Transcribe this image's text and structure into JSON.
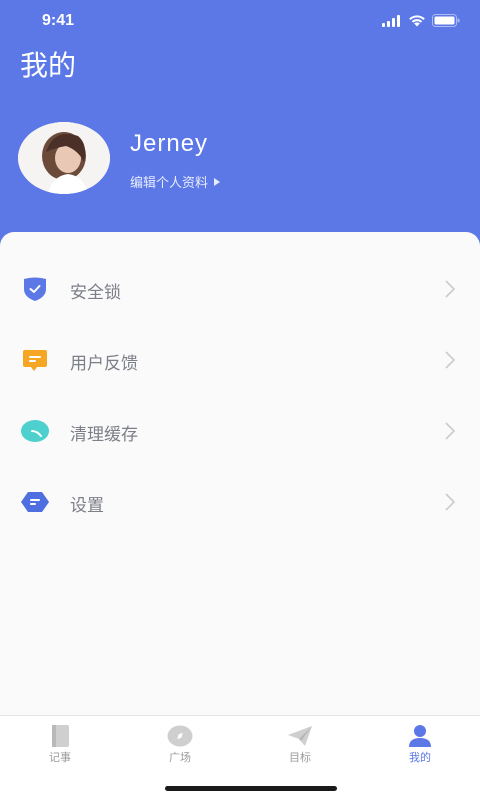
{
  "status": {
    "time": "9:41"
  },
  "page_title": "我的",
  "profile": {
    "name": "Jerney",
    "edit_label": "编辑个人资料"
  },
  "menu": [
    {
      "label": "安全锁",
      "icon": "shield-check-icon"
    },
    {
      "label": "用户反馈",
      "icon": "feedback-message-icon"
    },
    {
      "label": "清理缓存",
      "icon": "clean-cache-icon"
    },
    {
      "label": "设置",
      "icon": "settings-hexagon-icon"
    }
  ],
  "tabs": [
    {
      "label": "记事",
      "icon": "notebook-icon"
    },
    {
      "label": "广场",
      "icon": "compass-icon"
    },
    {
      "label": "目标",
      "icon": "paper-plane-icon"
    },
    {
      "label": "我的",
      "icon": "person-icon",
      "active": true
    }
  ],
  "colors": {
    "primary": "#5b78e6",
    "shield": "#5b78e6",
    "feedback": "#f5a623",
    "cache": "#4ed0cf",
    "settings": "#4f6fe0"
  }
}
